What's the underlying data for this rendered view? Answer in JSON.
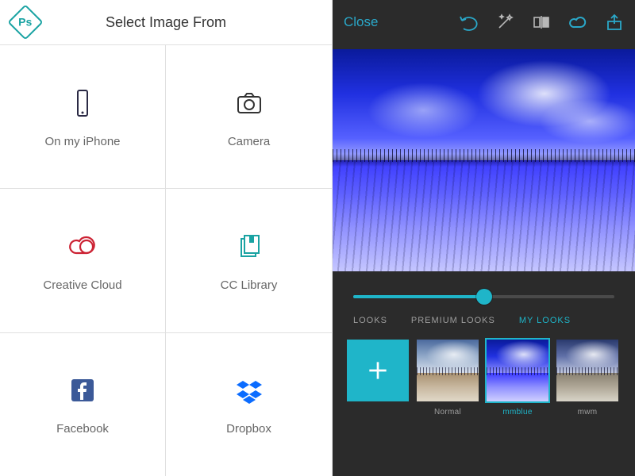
{
  "left": {
    "logo": "Ps",
    "title": "Select Image From",
    "sources": [
      {
        "label": "On my iPhone",
        "icon": "phone-icon"
      },
      {
        "label": "Camera",
        "icon": "camera-icon"
      },
      {
        "label": "Creative Cloud",
        "icon": "creative-cloud-icon"
      },
      {
        "label": "CC Library",
        "icon": "library-icon"
      },
      {
        "label": "Facebook",
        "icon": "facebook-icon"
      },
      {
        "label": "Dropbox",
        "icon": "dropbox-icon"
      }
    ]
  },
  "right": {
    "close": "Close",
    "slider_pct": 50,
    "tabs": [
      {
        "label": "LOOKS",
        "active": false
      },
      {
        "label": "PREMIUM LOOKS",
        "active": false
      },
      {
        "label": "MY LOOKS",
        "active": true
      }
    ],
    "thumbs": [
      {
        "kind": "add",
        "label": ""
      },
      {
        "kind": "normal",
        "label": "Normal",
        "selected": false
      },
      {
        "kind": "mmblue",
        "label": "mmblue",
        "selected": true
      },
      {
        "kind": "mwm",
        "label": "mwm",
        "selected": false
      }
    ],
    "colors": {
      "accent": "#1fb5c9"
    }
  }
}
